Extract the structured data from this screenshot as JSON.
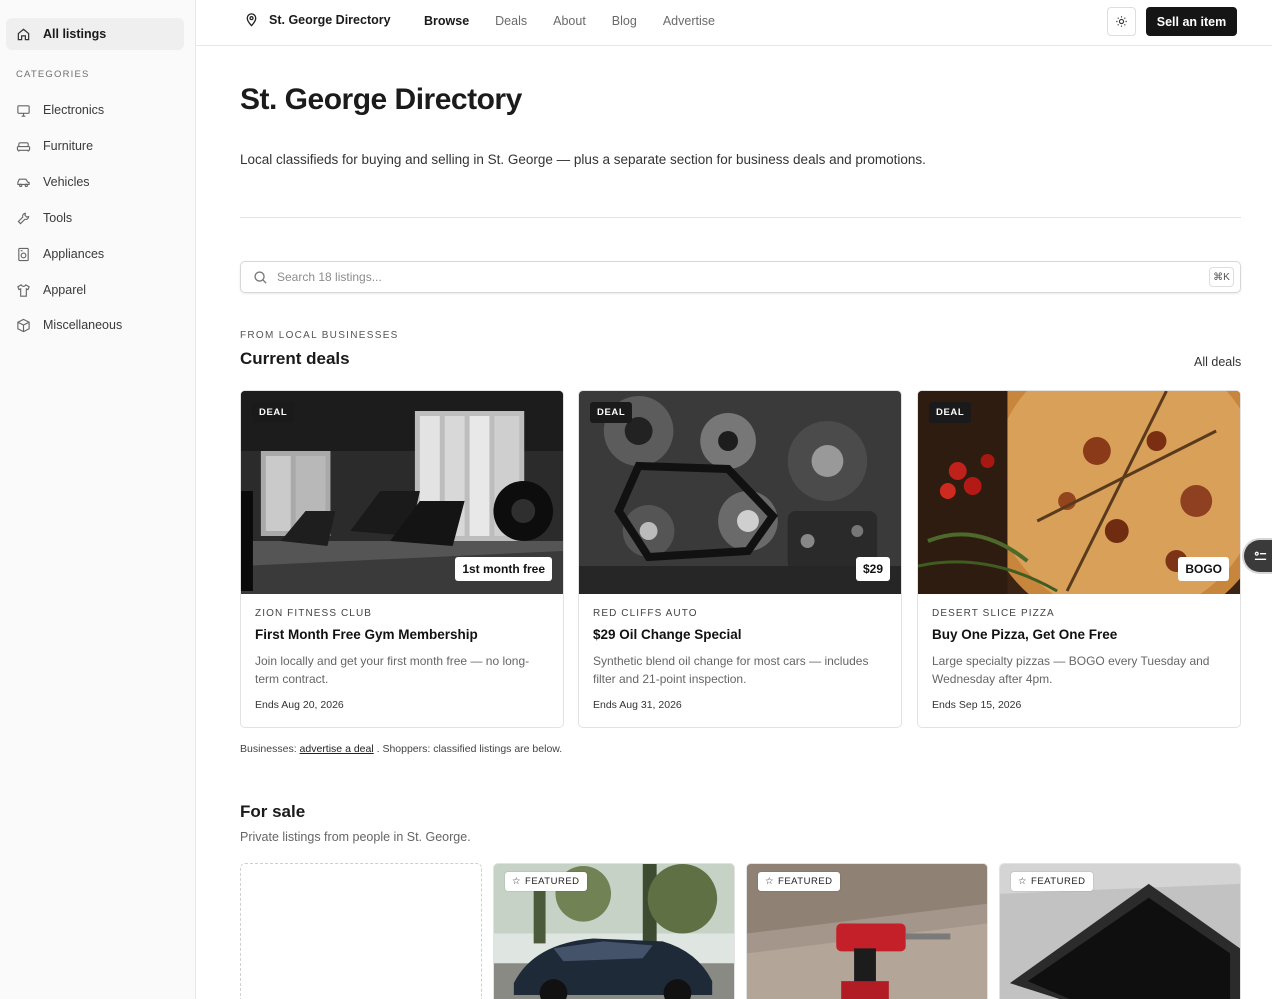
{
  "sidebar": {
    "all_label": "All listings",
    "categories_heading": "CATEGORIES",
    "items": [
      {
        "label": "Electronics",
        "icon": "monitor-icon"
      },
      {
        "label": "Furniture",
        "icon": "sofa-icon"
      },
      {
        "label": "Vehicles",
        "icon": "car-icon"
      },
      {
        "label": "Tools",
        "icon": "wrench-icon"
      },
      {
        "label": "Appliances",
        "icon": "appliance-icon"
      },
      {
        "label": "Apparel",
        "icon": "shirt-icon"
      },
      {
        "label": "Miscellaneous",
        "icon": "box-icon"
      }
    ]
  },
  "header": {
    "brand": "St. George Directory",
    "nav": [
      "Browse",
      "Deals",
      "About",
      "Blog",
      "Advertise"
    ],
    "active_nav": "Browse",
    "sell_label": "Sell an item"
  },
  "main": {
    "title": "St. George Directory",
    "subtitle": "Local classifieds for buying and selling in St. George — plus a separate section for business deals and promotions.",
    "search_placeholder": "Search 18 listings...",
    "search_shortcut": "⌘K"
  },
  "deals": {
    "eyebrow": "FROM LOCAL BUSINESSES",
    "heading": "Current deals",
    "all_link": "All deals",
    "cards": [
      {
        "badge": "DEAL",
        "price": "1st month free",
        "business": "ZION FITNESS CLUB",
        "title": "First Month Free Gym Membership",
        "description": "Join locally and get your first month free — no long-term contract.",
        "ends": "Ends Aug 20, 2026"
      },
      {
        "badge": "DEAL",
        "price": "$29",
        "business": "RED CLIFFS AUTO",
        "title": "$29 Oil Change Special",
        "description": "Synthetic blend oil change for most cars — includes filter and 21-point inspection.",
        "ends": "Ends Aug 31, 2026"
      },
      {
        "badge": "DEAL",
        "price": "BOGO",
        "business": "DESERT SLICE PIZZA",
        "title": "Buy One Pizza, Get One Free",
        "description": "Large specialty pizzas — BOGO every Tuesday and Wednesday after 4pm.",
        "ends": "Ends Sep 15, 2026"
      }
    ],
    "note_prefix": "Businesses:",
    "note_link": "advertise a deal",
    "note_suffix": ". Shoppers: classified listings are below."
  },
  "for_sale": {
    "heading": "For sale",
    "subtitle": "Private listings from people in St. George.",
    "featured_badge": "FEATURED"
  }
}
